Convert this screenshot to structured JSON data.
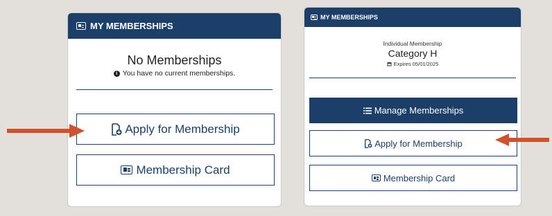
{
  "left_panel": {
    "header_title": "MY MEMBERSHIPS",
    "status_title": "No Memberships",
    "status_note": "You have no current memberships.",
    "apply_label": "Apply for Membership",
    "card_label": "Membership Card"
  },
  "right_panel": {
    "header_title": "MY MEMBERSHIPS",
    "membership_type": "Individual Membership",
    "category": "Category H",
    "expires": "Expires 05/01/2025",
    "manage_label": "Manage Memberships",
    "apply_label": "Apply for Membership",
    "card_label": "Membership Card"
  },
  "icons": {
    "header": "membership-card-icon",
    "info": "info-icon",
    "apply": "document-plus-icon",
    "card": "membership-card-icon",
    "calendar": "calendar-icon",
    "manage": "list-icon",
    "annotation": "red-arrow"
  },
  "colors": {
    "navy": "#1b3f69",
    "arrow": "#d2502a",
    "background": "#e3dfdb"
  }
}
